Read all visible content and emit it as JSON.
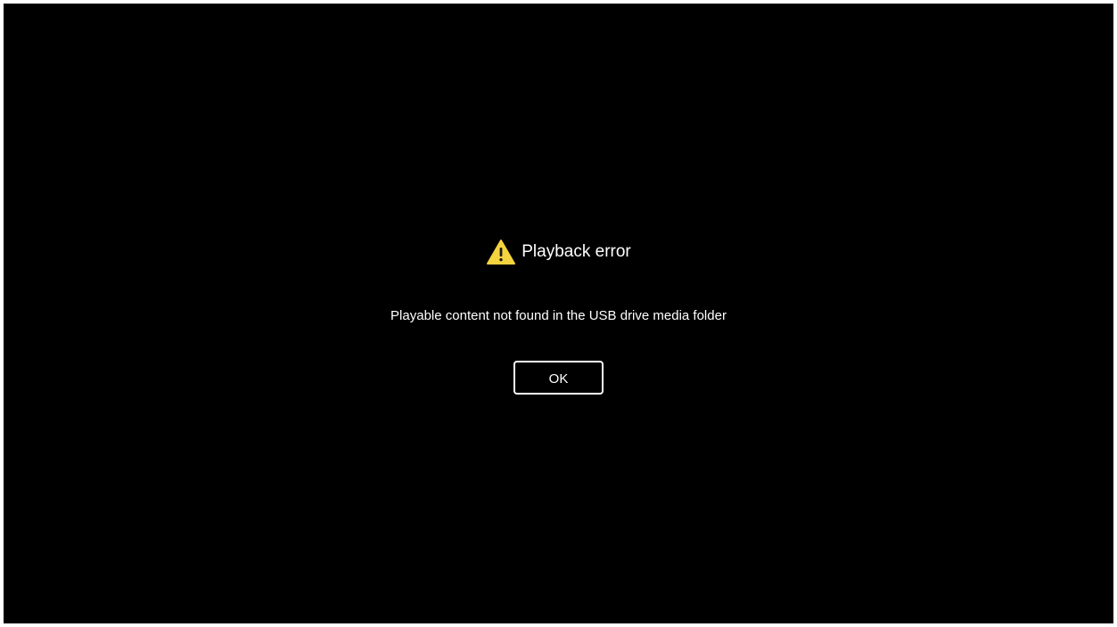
{
  "dialog": {
    "icon": "warning-triangle-icon",
    "icon_color": "#f5d33f",
    "title": "Playback error",
    "message": "Playable content not found in the USB drive media folder",
    "ok_label": "OK"
  },
  "colors": {
    "background": "#000000",
    "text": "#ffffff"
  }
}
